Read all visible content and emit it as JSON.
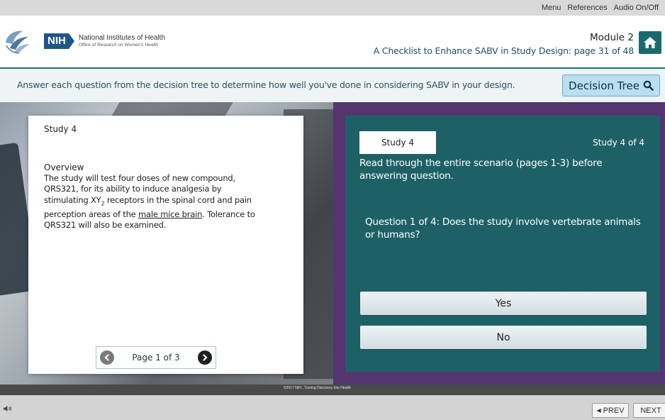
{
  "topbar": {
    "menu": "Menu",
    "references": "References",
    "audio": "Audio On/Off"
  },
  "header": {
    "nih_abbr": "NIH",
    "org_name": "National Institutes of Health",
    "org_sub": "Office of Research on Women's Health",
    "module": "Module 2",
    "page_title": "A Checklist to Enhance SABV in Study Design: page 31 of 48"
  },
  "instructions": {
    "text": "Answer each question from the decision tree to determine how well you've done in considering SABV in your design.",
    "decision_tree_label": "Decision Tree"
  },
  "study_card": {
    "title": "Study 4",
    "overview_heading": "Overview",
    "overview_text_1": "The study will test four doses of new compound, QRS321, for its ability to induce analgesia by stimulating XY",
    "overview_subscript": "2",
    "overview_text_2": " receptors in the spinal cord and pain perception areas of the ",
    "overview_link": "male mice brain",
    "overview_text_3": ". Tolerance to QRS321 will also be examined.",
    "pager_label": "Page 1 of 3"
  },
  "question_panel": {
    "study_tab": "Study 4",
    "study_count": "Study 4  of  4",
    "read_note": "Read through the entire scenario (pages 1-3) before answering question.",
    "question": "Question 1 of 4: Does the study involve vertebrate animals or humans?",
    "answers": [
      "Yes",
      "No"
    ]
  },
  "footer": {
    "copyright": "©2017 NIH...Turning Discovery Into Health",
    "prev": "PREV",
    "next": "NEXT"
  },
  "icons": {
    "home": "home-icon",
    "search": "search-icon",
    "prev": "chevron-left-icon",
    "next": "chevron-right-icon",
    "audio": "speaker-icon",
    "logo": "hhs-eagle-logo"
  },
  "colors": {
    "teal_panel": "#1d6166",
    "purple_bg": "#54356f",
    "nih_blue": "#20558a",
    "decision_tree_btn": "#b9dff0"
  }
}
